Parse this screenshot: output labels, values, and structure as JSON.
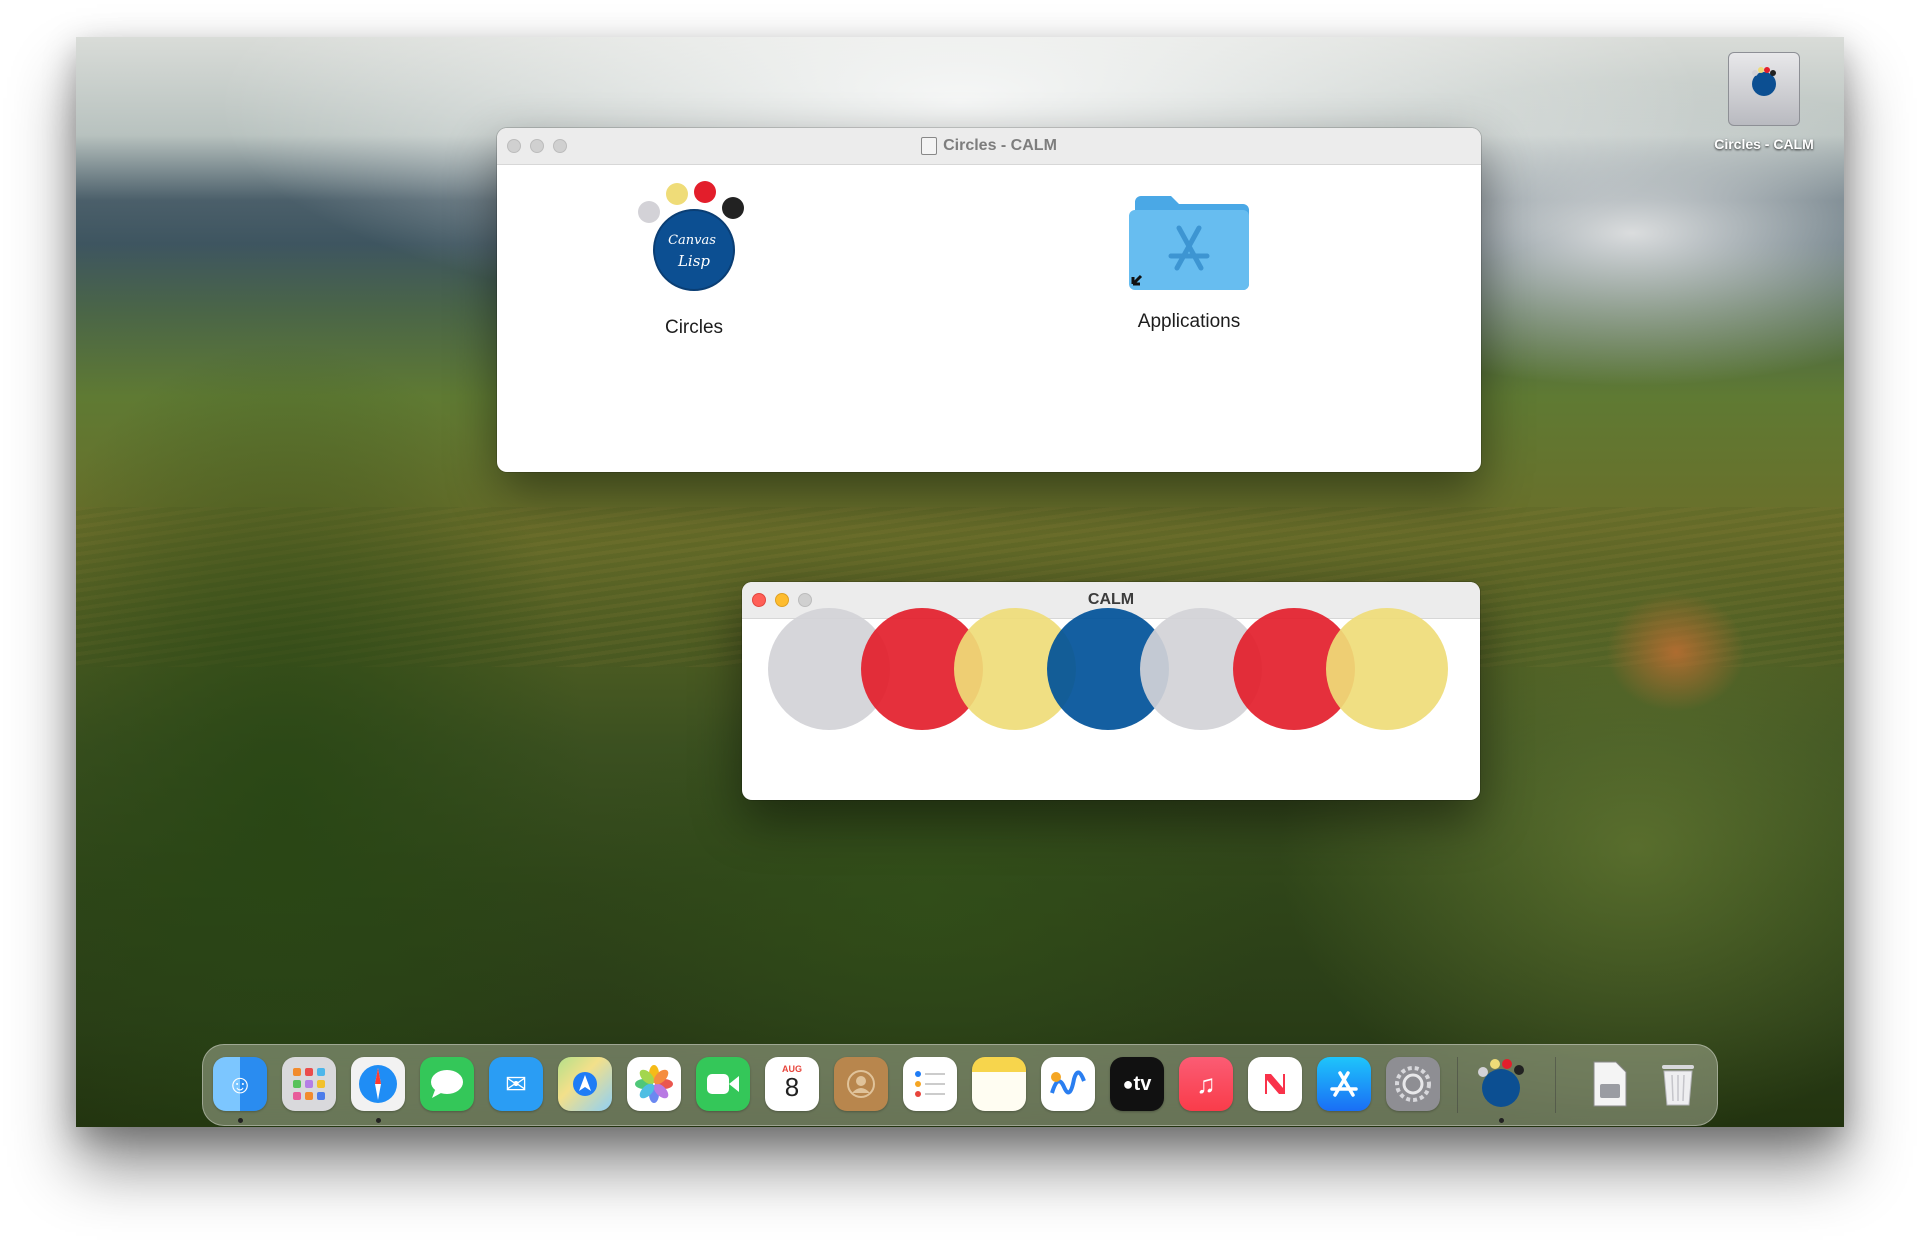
{
  "desktop": {
    "volume_label": "Circles - CALM"
  },
  "finder_window": {
    "title": "Circles - CALM",
    "items": [
      {
        "label": "Circles"
      },
      {
        "label": "Applications"
      }
    ]
  },
  "calm_window": {
    "title": "CALM",
    "circles": [
      "#d3d2d7",
      "#e31e2b",
      "#efdc78",
      "#005199",
      "#d3d2d7",
      "#e31e2b",
      "#efdc78"
    ]
  },
  "logo": {
    "text_top": "Canvas",
    "text_bottom": "Lisp",
    "dot_colors": [
      "#d3d2d7",
      "#efdc78",
      "#e31e2b",
      "#222222"
    ],
    "disc_color": "#0c4f92"
  },
  "dock": {
    "calendar_month": "AUG",
    "calendar_day": "8",
    "tv_label": "tv",
    "apps": [
      "finder-icon",
      "launchpad-icon",
      "safari-icon",
      "messages-icon",
      "mail-icon",
      "maps-icon",
      "photos-icon",
      "facetime-icon",
      "calendar-icon",
      "contacts-icon",
      "reminders-icon",
      "notes-icon",
      "freeform-icon",
      "tv-icon",
      "music-icon",
      "news-icon",
      "app-store-icon",
      "system-settings-icon",
      "circles-app-icon",
      "disk-image-icon",
      "trash-icon"
    ]
  }
}
